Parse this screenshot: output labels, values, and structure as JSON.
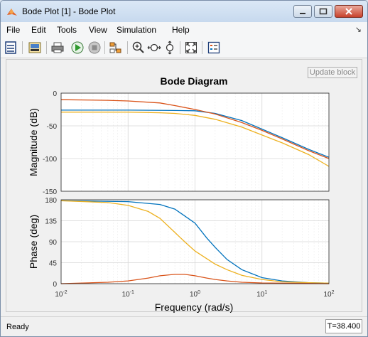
{
  "window": {
    "title": "Bode Plot [1] - Bode Plot"
  },
  "menu": {
    "items": [
      "File",
      "Edit",
      "Tools",
      "View",
      "Simulation",
      "Help"
    ]
  },
  "toolbar": {
    "update_label": "Update block"
  },
  "status": {
    "text": "Ready",
    "time": "T=38.400"
  },
  "colors": {
    "blue": "#0072bd",
    "orange": "#d95319",
    "yellow": "#edb120",
    "grid": "#e1e1e1",
    "axis": "#262626"
  },
  "chart_data": {
    "type": "line",
    "title": "Bode Diagram",
    "xlabel": "Frequency  (rad/s)",
    "x_scale": "log",
    "xlim": [
      0.01,
      100
    ],
    "x_ticks": [
      "10-2",
      "10-1",
      "100",
      "101",
      "102"
    ],
    "grid": true,
    "subplots": [
      {
        "name": "magnitude",
        "ylabel": "Magnitude (dB)",
        "ylim": [
          -150,
          0
        ],
        "y_ticks": [
          "0",
          "-50",
          "-100",
          "-150"
        ],
        "series": [
          {
            "color": "blue",
            "x": [
              0.01,
              0.1,
              0.5,
              1,
              2,
              5,
              10,
              20,
              50,
              100
            ],
            "y": [
              -26,
              -26,
              -26.5,
              -27,
              -31,
              -42,
              -55,
              -68,
              -86,
              -98
            ]
          },
          {
            "color": "orange",
            "x": [
              0.01,
              0.05,
              0.1,
              0.3,
              0.5,
              1,
              2,
              5,
              10,
              20,
              50,
              100
            ],
            "y": [
              -10,
              -11,
              -12,
              -15,
              -19,
              -25,
              -32,
              -45,
              -57,
              -70,
              -88,
              -100
            ]
          },
          {
            "color": "yellow",
            "x": [
              0.01,
              0.1,
              0.3,
              0.5,
              1,
              2,
              5,
              10,
              20,
              50,
              100
            ],
            "y": [
              -29,
              -29,
              -30,
              -31,
              -34,
              -40,
              -52,
              -64,
              -76,
              -94,
              -112
            ]
          }
        ]
      },
      {
        "name": "phase",
        "ylabel": "Phase (deg)",
        "ylim": [
          0,
          180
        ],
        "y_ticks": [
          "180",
          "135",
          "90",
          "45",
          "0"
        ],
        "series": [
          {
            "color": "blue",
            "x": [
              0.01,
              0.1,
              0.3,
              0.5,
              1,
              1.5,
              2,
              3,
              5,
              10,
              20,
              50,
              100
            ],
            "y": [
              178,
              176,
              170,
              160,
              130,
              98,
              78,
              52,
              30,
              13,
              6,
              2,
              1
            ]
          },
          {
            "color": "yellow",
            "x": [
              0.01,
              0.05,
              0.1,
              0.2,
              0.3,
              0.5,
              0.7,
              1,
              2,
              3,
              5,
              10,
              20,
              50,
              100
            ],
            "y": [
              178,
              174,
              168,
              155,
              140,
              110,
              90,
              70,
              42,
              30,
              18,
              9,
              4,
              2,
              1
            ]
          },
          {
            "color": "orange",
            "x": [
              0.01,
              0.05,
              0.1,
              0.2,
              0.3,
              0.5,
              0.7,
              1,
              1.5,
              2,
              3,
              5,
              10,
              20,
              50,
              100
            ],
            "y": [
              0,
              3,
              6,
              12,
              17,
              20,
              20,
              17,
              12,
              9,
              6,
              3,
              1.5,
              1,
              0.5,
              0
            ]
          }
        ]
      }
    ]
  }
}
